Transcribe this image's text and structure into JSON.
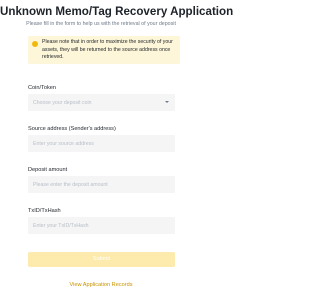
{
  "header": {
    "title": "Unknown Memo/Tag Recovery Application",
    "subtitle": "Please fill in the form to help us with the retrieval of your deposit"
  },
  "notice": {
    "text": "Please note that in order to maximize the security of your assets, they will be returned to the source address once retrieved.",
    "icon": "dot-icon",
    "color": "#f0b90b",
    "background": "#fef6d8"
  },
  "form": {
    "coin": {
      "label": "Coin/Token",
      "placeholder": "Choose your deposit coin"
    },
    "source_address": {
      "label": "Source address (Sender's address)",
      "placeholder": "Enter your source address"
    },
    "deposit_amount": {
      "label": "Deposit amount",
      "placeholder": "Please enter the deposit amount"
    },
    "txid": {
      "label": "TxID/TxHash",
      "placeholder": "Enter your TxID/TxHash"
    },
    "submit_label": "Submit"
  },
  "footer": {
    "link_label": "View Application Records"
  },
  "colors": {
    "accent": "#f0b90b",
    "button_disabled": "#fcebad",
    "link": "#c99400"
  }
}
